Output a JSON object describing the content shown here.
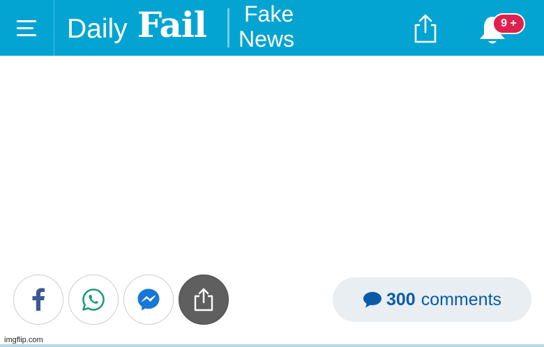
{
  "header": {
    "brand_daily": "Daily",
    "brand_fail": "Fail",
    "section_line1": "Fake",
    "section_line2": "News",
    "notification_badge": "9 +",
    "background_color": "#04a4d2",
    "badge_color": "#e0214f"
  },
  "icons": {
    "menu": "hamburger-icon",
    "share_top": "share-icon",
    "bell": "bell-icon",
    "facebook": "facebook-icon",
    "whatsapp": "whatsapp-icon",
    "messenger": "messenger-icon",
    "share_bottom": "share-icon",
    "comment": "speech-bubble-icon"
  },
  "actions": {
    "comments_count": "300",
    "comments_label": "comments"
  },
  "watermark": "imgflip.com"
}
